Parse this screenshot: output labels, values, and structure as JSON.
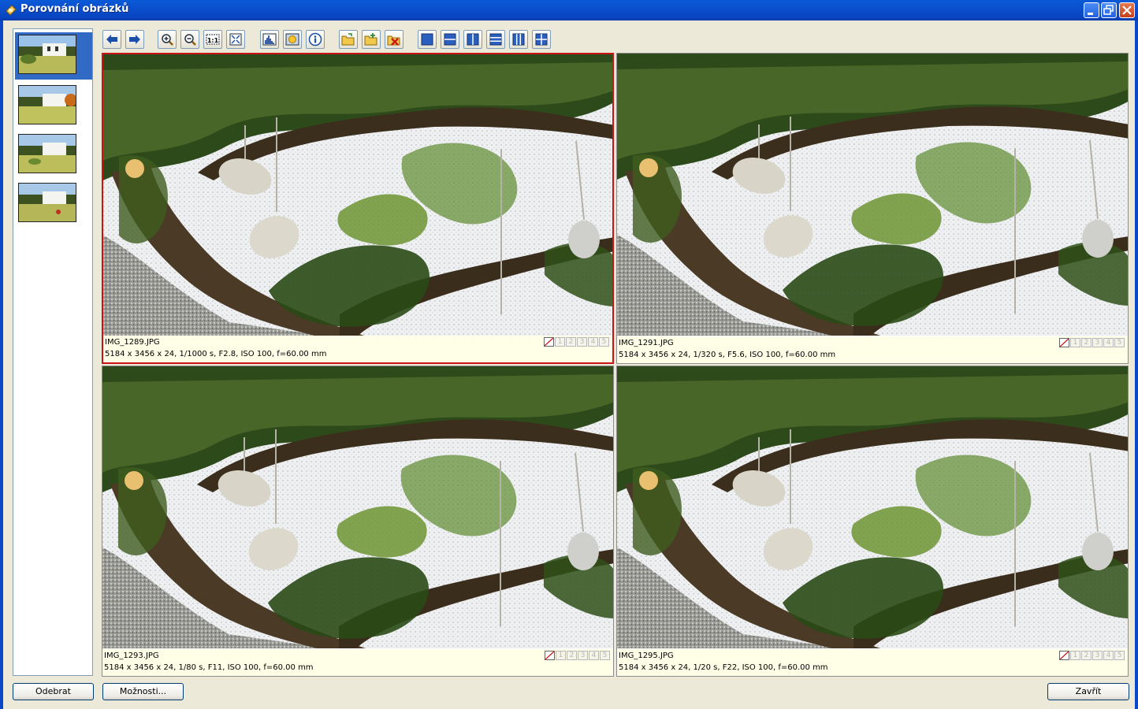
{
  "window": {
    "title": "Porovnání obrázků"
  },
  "toolbar": {
    "buttons": [
      {
        "icon": "arrow-left-icon",
        "name": "previous-button"
      },
      {
        "icon": "arrow-right-icon",
        "name": "next-button"
      },
      {
        "icon": "zoom-in-icon",
        "name": "zoom-in-button"
      },
      {
        "icon": "zoom-out-icon",
        "name": "zoom-out-button"
      },
      {
        "icon": "actual-size-icon",
        "name": "actual-size-button",
        "label": "1:1"
      },
      {
        "icon": "fit-icon",
        "name": "fit-to-window-button"
      },
      {
        "icon": "histogram-icon",
        "name": "histogram-button"
      },
      {
        "icon": "highlights-icon",
        "name": "highlights-button"
      },
      {
        "icon": "info-icon",
        "name": "info-button"
      },
      {
        "icon": "open-folder-icon",
        "name": "open-button"
      },
      {
        "icon": "copy-folder-icon",
        "name": "copy-button"
      },
      {
        "icon": "delete-icon",
        "name": "delete-button"
      },
      {
        "icon": "layout-single-icon",
        "name": "layout-single-button"
      },
      {
        "icon": "layout-2-horizontal-icon",
        "name": "layout-2-rows-button"
      },
      {
        "icon": "layout-2-vertical-icon",
        "name": "layout-2-columns-button"
      },
      {
        "icon": "layout-3-horizontal-icon",
        "name": "layout-3-rows-button"
      },
      {
        "icon": "layout-3-vertical-icon",
        "name": "layout-3-columns-button"
      },
      {
        "icon": "layout-grid-icon",
        "name": "layout-grid-button"
      }
    ]
  },
  "thumbnails": {
    "count": 4,
    "selected_index": 0
  },
  "panes": [
    {
      "filename": "IMG_1289.JPG",
      "meta": "5184 x 3456 x 24, 1/1000 s, F2.8, ISO 100, f=60.00 mm",
      "active": true
    },
    {
      "filename": "IMG_1291.JPG",
      "meta": "5184 x 3456 x 24, 1/320 s, F5.6, ISO 100, f=60.00 mm",
      "active": false
    },
    {
      "filename": "IMG_1293.JPG",
      "meta": "5184 x 3456 x 24, 1/80 s, F11, ISO 100, f=60.00 mm",
      "active": false
    },
    {
      "filename": "IMG_1295.JPG",
      "meta": "5184 x 3456 x 24, 1/20 s, F22, ISO 100, f=60.00 mm",
      "active": false
    }
  ],
  "rating_labels": [
    "1",
    "2",
    "3",
    "4",
    "5"
  ],
  "buttons": {
    "remove": "Odebrat",
    "options": "Možnosti...",
    "close": "Zavřít"
  }
}
